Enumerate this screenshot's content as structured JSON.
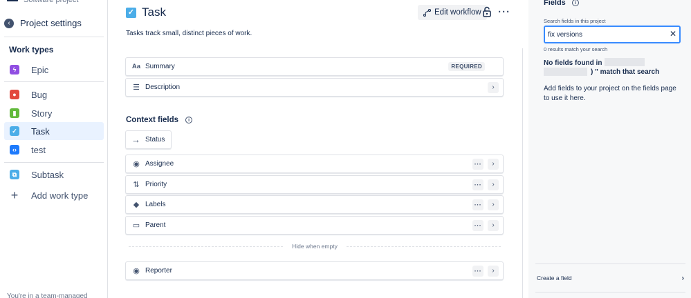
{
  "sidebar": {
    "project_type": "Software project",
    "back_label": "Project settings",
    "heading": "Work types",
    "items": [
      {
        "label": "Epic",
        "color": "#904ee2",
        "icon": "lightning-icon"
      },
      {
        "label": "Bug",
        "color": "#e2483d",
        "icon": "bug-icon"
      },
      {
        "label": "Story",
        "color": "#63ba3c",
        "icon": "bookmark-icon"
      },
      {
        "label": "Task",
        "color": "#4bade8",
        "icon": "checkbox-icon"
      },
      {
        "label": "test",
        "color": "#1d7afc",
        "icon": "code-icon"
      },
      {
        "label": "Subtask",
        "color": "#4bade8",
        "icon": "subtask-icon"
      }
    ],
    "add_label": "Add work type",
    "footer": "You're in a team-managed project"
  },
  "main": {
    "title": "Task",
    "description": "Tasks track small, distinct pieces of work.",
    "edit_workflow": "Edit workflow",
    "fields": [
      {
        "label": "Summary",
        "badge": "REQUIRED",
        "icon": "Aa"
      },
      {
        "label": "Description",
        "icon": "☰"
      }
    ],
    "context_heading": "Context fields",
    "status_label": "Status",
    "context_fields": [
      {
        "label": "Assignee",
        "icon": "user-icon"
      },
      {
        "label": "Priority",
        "icon": "priority-icon"
      },
      {
        "label": "Labels",
        "icon": "tag-icon"
      },
      {
        "label": "Parent",
        "icon": "parent-icon"
      }
    ],
    "hide_when_empty": "Hide when empty",
    "hidden_fields": [
      {
        "label": "Reporter",
        "icon": "user-icon"
      }
    ]
  },
  "panel": {
    "title": "Fields",
    "search_label": "Search fields in this project",
    "search_value": "fix versions",
    "results": "0 results match your search",
    "no_found": "No fields found in",
    "match": ") \" match that search",
    "help": "Add fields to your project on the fields page to use it here.",
    "create": "Create a field"
  }
}
